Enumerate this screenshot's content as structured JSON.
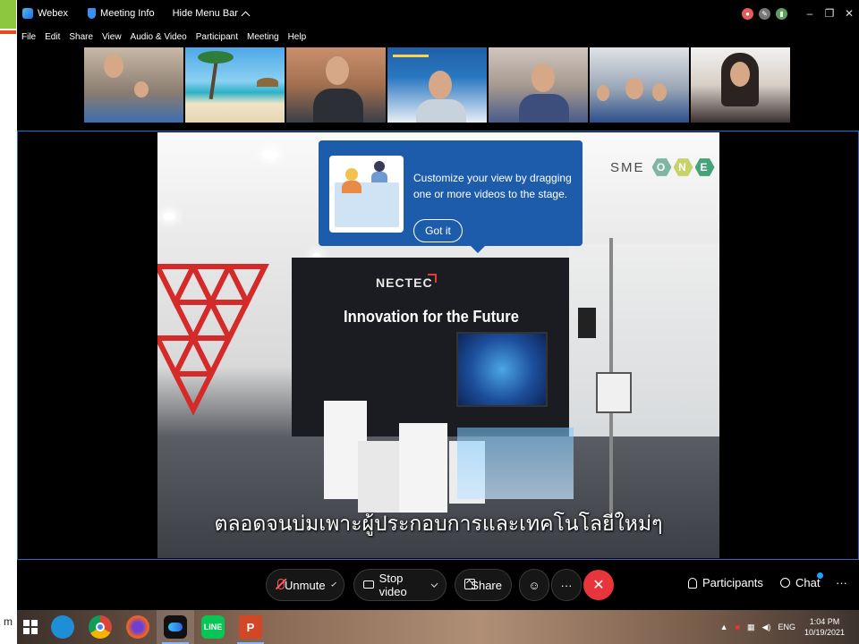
{
  "titlebar": {
    "app_name": "Webex",
    "meeting_info": "Meeting Info",
    "hide_menu": "Hide Menu Bar",
    "window_buttons": [
      "–",
      "❐",
      "✕"
    ]
  },
  "menubar": {
    "items": [
      "File",
      "Edit",
      "Share",
      "View",
      "Audio & Video",
      "Participant",
      "Meeting",
      "Help"
    ]
  },
  "stage": {
    "sme_one": {
      "sme": "SME",
      "one": [
        "O",
        "N",
        "E"
      ]
    },
    "brand": "NECTEC",
    "headline": "Innovation for the Future",
    "subtitle": "ตลอดจนบ่มเพาะผู้ประกอบการและเทคโนโลยีใหม่ๆ"
  },
  "tooltip": {
    "text": "Customize your view by dragging one or more videos to the stage.",
    "button": "Got it"
  },
  "controls": {
    "unmute": "Unmute",
    "stop_video": "Stop video",
    "share": "Share",
    "more": "···",
    "end": "✕",
    "participants": "Participants",
    "chat": "Chat",
    "overflow": "···"
  },
  "taskbar": {
    "apps": [
      {
        "name": "edge",
        "color": "#1e8fd6"
      },
      {
        "name": "chrome",
        "color": "#e3b43a"
      },
      {
        "name": "firefox",
        "color": "#e8622b"
      },
      {
        "name": "webex",
        "color": "#2b6fd3"
      },
      {
        "name": "line",
        "color": "#06c755",
        "label": "LINE"
      },
      {
        "name": "powerpoint",
        "color": "#d24726",
        "label": "P"
      }
    ],
    "lang": "ENG",
    "time": "1:04 PM",
    "date": "10/19/2021"
  },
  "slide_fragment": "m"
}
